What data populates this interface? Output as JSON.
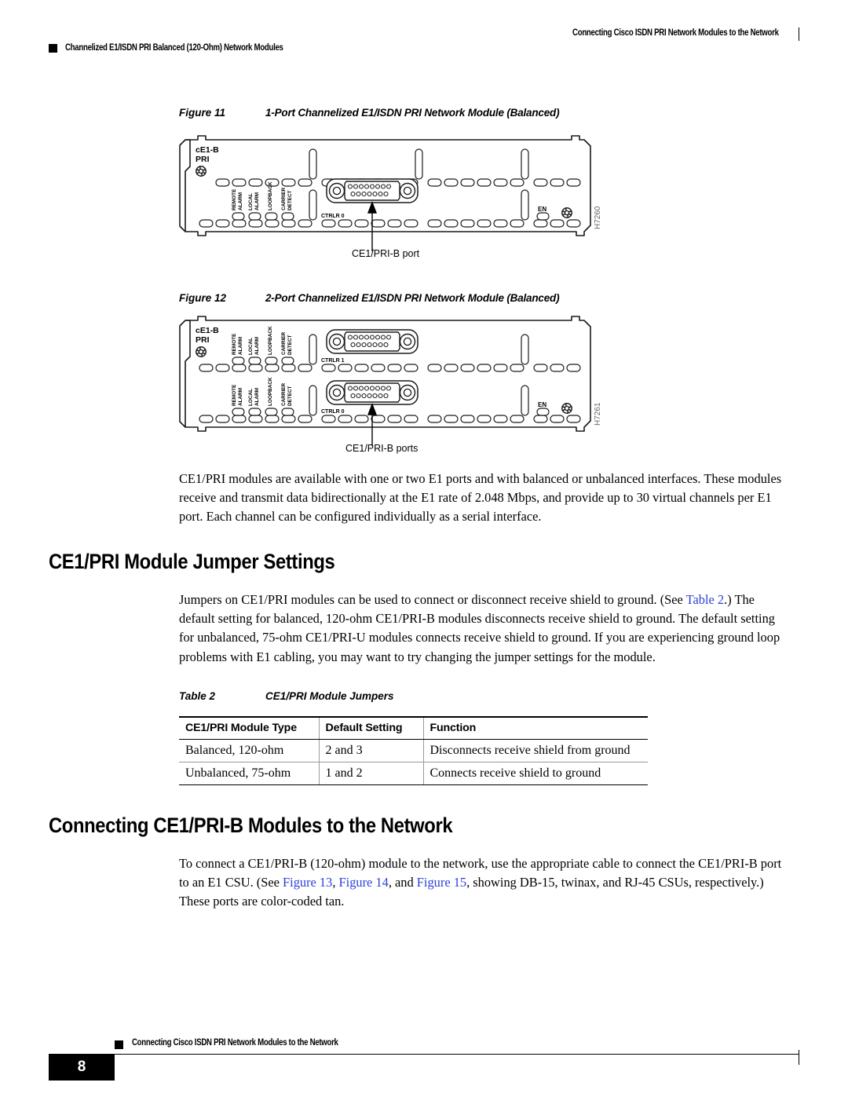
{
  "header": {
    "right_title": "Connecting Cisco ISDN PRI Network Modules to the Network",
    "left_title": "Channelized E1/ISDN PRI Balanced (120-Ohm) Network Modules"
  },
  "figure11": {
    "label": "Figure 11",
    "title": "1-Port Channelized E1/ISDN PRI Network Module (Balanced)",
    "module_label_line1": "cE1-B",
    "module_label_line2": "PRI",
    "leds": [
      "REMOTE ALARM",
      "LOCAL ALARM",
      "LOOPBACK",
      "CARRIER DETECT"
    ],
    "controller_label": "CTRLR 0",
    "enable_label": "EN",
    "art_id": "H7260",
    "callout": "CE1/PRI-B port"
  },
  "figure12": {
    "label": "Figure 12",
    "title": "2-Port Channelized E1/ISDN PRI Network Module (Balanced)",
    "module_label_line1": "cE1-B",
    "module_label_line2": "PRI",
    "leds": [
      "REMOTE ALARM",
      "LOCAL ALARM",
      "LOOPBACK",
      "CARRIER DETECT"
    ],
    "controller_label_top": "CTRLR 1",
    "controller_label_bottom": "CTRLR 0",
    "enable_label": "EN",
    "art_id": "H7261",
    "callout": "CE1/PRI-B ports"
  },
  "intro_paragraph": "CE1/PRI modules are available with one or two E1 ports and with balanced or unbalanced interfaces. These modules receive and transmit data bidirectionally at the E1 rate of 2.048 Mbps, and provide up to 30 virtual channels per E1 port. Each channel can be configured individually as a serial interface.",
  "section_jumper": {
    "heading": "CE1/PRI Module Jumper Settings",
    "para_part1": "Jumpers on CE1/PRI modules can be used to connect or disconnect receive shield to ground. (See ",
    "link_table2": "Table 2",
    "para_part2": ".) The default setting for balanced, 120-ohm CE1/PRI-B modules disconnects receive shield to ground. The default setting for unbalanced, 75-ohm CE1/PRI-U modules connects receive shield to ground. If you are experiencing ground loop problems with E1 cabling, you may want to try changing the jumper settings for the module."
  },
  "table2": {
    "label": "Table 2",
    "title": "CE1/PRI Module Jumpers",
    "columns": [
      "CE1/PRI Module Type",
      "Default Setting",
      "Function"
    ],
    "rows": [
      [
        "Balanced, 120-ohm",
        "2 and 3",
        "Disconnects receive shield from ground"
      ],
      [
        "Unbalanced, 75-ohm",
        "1 and 2",
        "Connects receive shield to ground"
      ]
    ]
  },
  "section_connecting": {
    "heading": "Connecting CE1/PRI-B Modules to the Network",
    "para_part1": "To connect a CE1/PRI-B (120-ohm) module to the network, use the appropriate cable to connect the CE1/PRI-B port to an E1 CSU. (See ",
    "link_fig13": "Figure 13",
    "sep1": ", ",
    "link_fig14": "Figure 14",
    "sep2": ", and ",
    "link_fig15": "Figure 15",
    "para_part2": ", showing DB-15, twinax, and RJ-45 CSUs, respectively.) These ports are color-coded tan."
  },
  "footer": {
    "text": "Connecting Cisco ISDN PRI Network Modules to the Network",
    "page_number": "8"
  },
  "colors": {
    "link": "#2b3fd8",
    "rule": "#000000"
  }
}
